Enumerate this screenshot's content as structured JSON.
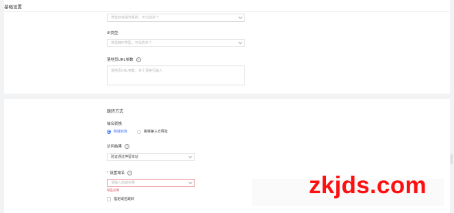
{
  "section": {
    "title": "基础设置"
  },
  "top_form": {
    "os_select": {
      "placeholder": "筛选目标操作系统，可勾选多个"
    },
    "ip_type": {
      "label": "IP类型",
      "placeholder": "筛选静IP类型，可勾选多个"
    },
    "landing_url_params": {
      "label": "落地页URL参数",
      "placeholder": "落地页URL参数，多个请换行输入"
    }
  },
  "redirect": {
    "title": "跳转方式",
    "domain_switch": {
      "label": "域名转换",
      "options": [
        {
          "label": "跨域双库",
          "checked": true
        },
        {
          "label": "跳转第三方网址",
          "checked": false
        }
      ]
    },
    "fail_result": {
      "label": "访问结果",
      "value": "验证通过停留本站"
    },
    "set_domain": {
      "required_mark": "*",
      "label": "设置域名",
      "placeholder": "请输入加域名称",
      "error": "域名必填"
    },
    "specify_domain": {
      "label": "指定域名跳转"
    }
  },
  "watermark": {
    "text": "zkjds.com"
  },
  "colors": {
    "accent": "#3b6ef5",
    "error": "#e34d59",
    "watermark": "#ff1010"
  }
}
